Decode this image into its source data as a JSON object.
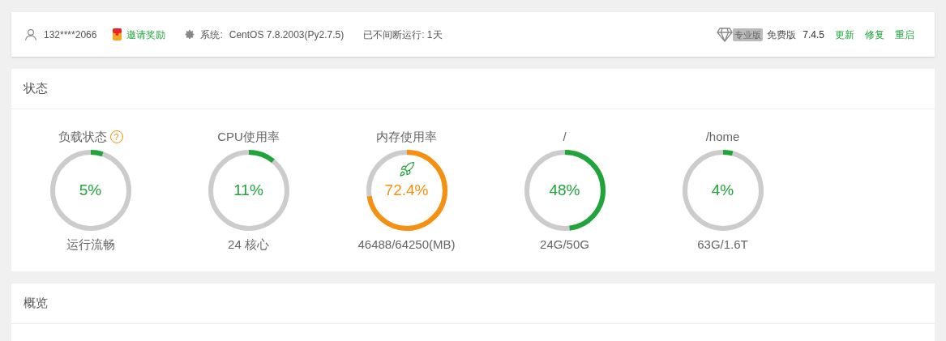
{
  "top_bar": {
    "user": "132****2066",
    "invite": "邀请奖励",
    "system_label": "系统:",
    "system_value": "CentOS 7.8.2003(Py2.7.5)",
    "uptime": "已不间断运行: 1天",
    "pro_badge": "专业版",
    "edition": "免费版",
    "version": "7.4.5",
    "actions": [
      "更新",
      "修复",
      "重启"
    ]
  },
  "status": {
    "title": "状态",
    "gauges": [
      {
        "label": "负载状态",
        "help": "?",
        "value": "5%",
        "level": 0.05,
        "color": "#20a53a",
        "boost": false,
        "caption": "运行流畅"
      },
      {
        "label": "CPU使用率",
        "value": "11%",
        "level": 0.11,
        "color": "#20a53a",
        "boost": false,
        "caption": "24 核心"
      },
      {
        "label": "内存使用率",
        "value": "72.4%",
        "level": 0.724,
        "color": "#f7900e",
        "boost": true,
        "caption": "46488/64250(MB)"
      },
      {
        "label": "/",
        "value": "48%",
        "level": 0.48,
        "color": "#20a53a",
        "boost": false,
        "caption": "24G/50G"
      },
      {
        "label": "/home",
        "value": "4%",
        "level": 0.04,
        "color": "#20a53a",
        "boost": false,
        "caption": "63G/1.6T"
      }
    ]
  },
  "overview": {
    "title": "概览"
  }
}
